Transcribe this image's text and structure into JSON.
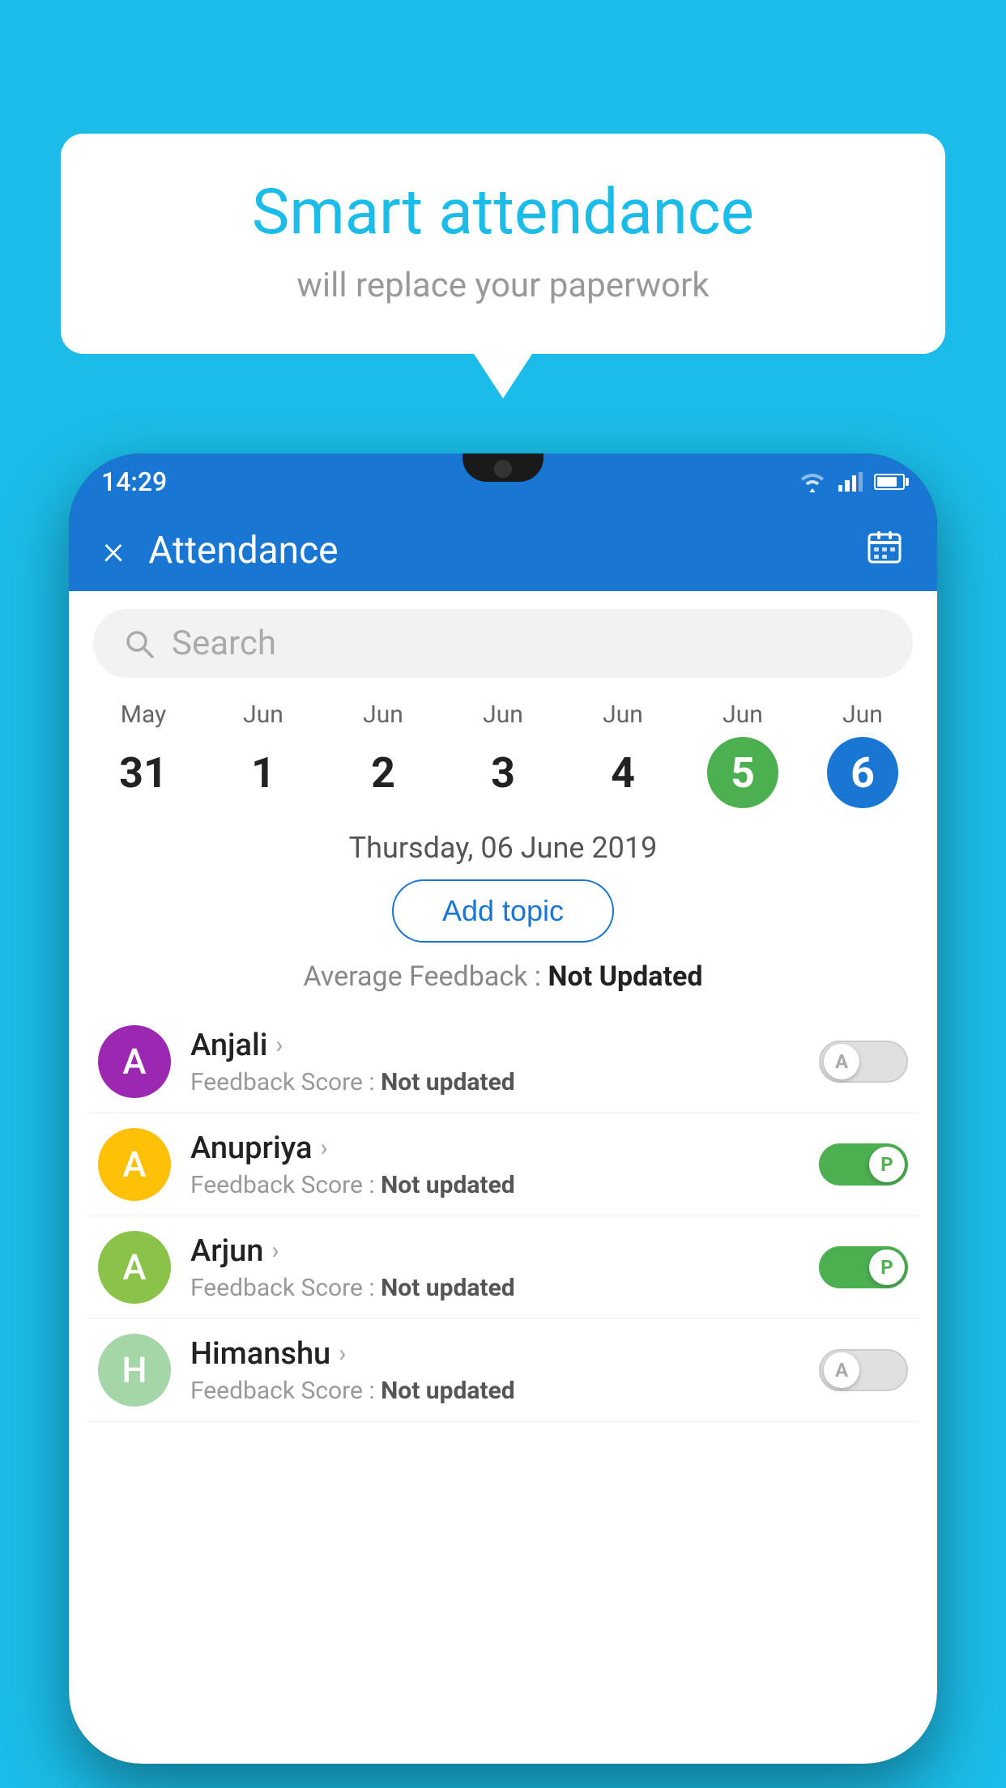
{
  "background_color": "#1BBDE8",
  "speech_bubble": {
    "title": "Smart attendance",
    "subtitle": "will replace your paperwork"
  },
  "status_bar": {
    "time": "14:29"
  },
  "app_header": {
    "title": "Attendance",
    "close_label": "×",
    "calendar_label": "📅"
  },
  "search": {
    "placeholder": "Search"
  },
  "calendar": {
    "days": [
      {
        "month": "May",
        "date": "31",
        "style": "normal"
      },
      {
        "month": "Jun",
        "date": "1",
        "style": "normal"
      },
      {
        "month": "Jun",
        "date": "2",
        "style": "normal"
      },
      {
        "month": "Jun",
        "date": "3",
        "style": "normal"
      },
      {
        "month": "Jun",
        "date": "4",
        "style": "normal"
      },
      {
        "month": "Jun",
        "date": "5",
        "style": "today"
      },
      {
        "month": "Jun",
        "date": "6",
        "style": "selected"
      }
    ]
  },
  "selected_date_label": "Thursday, 06 June 2019",
  "add_topic_label": "Add topic",
  "avg_feedback_label": "Average Feedback :",
  "avg_feedback_value": "Not Updated",
  "students": [
    {
      "name": "Anjali",
      "initial": "A",
      "avatar_color": "#9C27B0",
      "feedback_label": "Feedback Score :",
      "feedback_value": "Not updated",
      "toggle_state": "off",
      "toggle_label": "A"
    },
    {
      "name": "Anupriya",
      "initial": "A",
      "avatar_color": "#FFC107",
      "feedback_label": "Feedback Score :",
      "feedback_value": "Not updated",
      "toggle_state": "on",
      "toggle_label": "P"
    },
    {
      "name": "Arjun",
      "initial": "A",
      "avatar_color": "#8BC34A",
      "feedback_label": "Feedback Score :",
      "feedback_value": "Not updated",
      "toggle_state": "on",
      "toggle_label": "P"
    },
    {
      "name": "Himanshu",
      "initial": "H",
      "avatar_color": "#A5D6A7",
      "feedback_label": "Feedback Score :",
      "feedback_value": "Not updated",
      "toggle_state": "off",
      "toggle_label": "A"
    }
  ]
}
